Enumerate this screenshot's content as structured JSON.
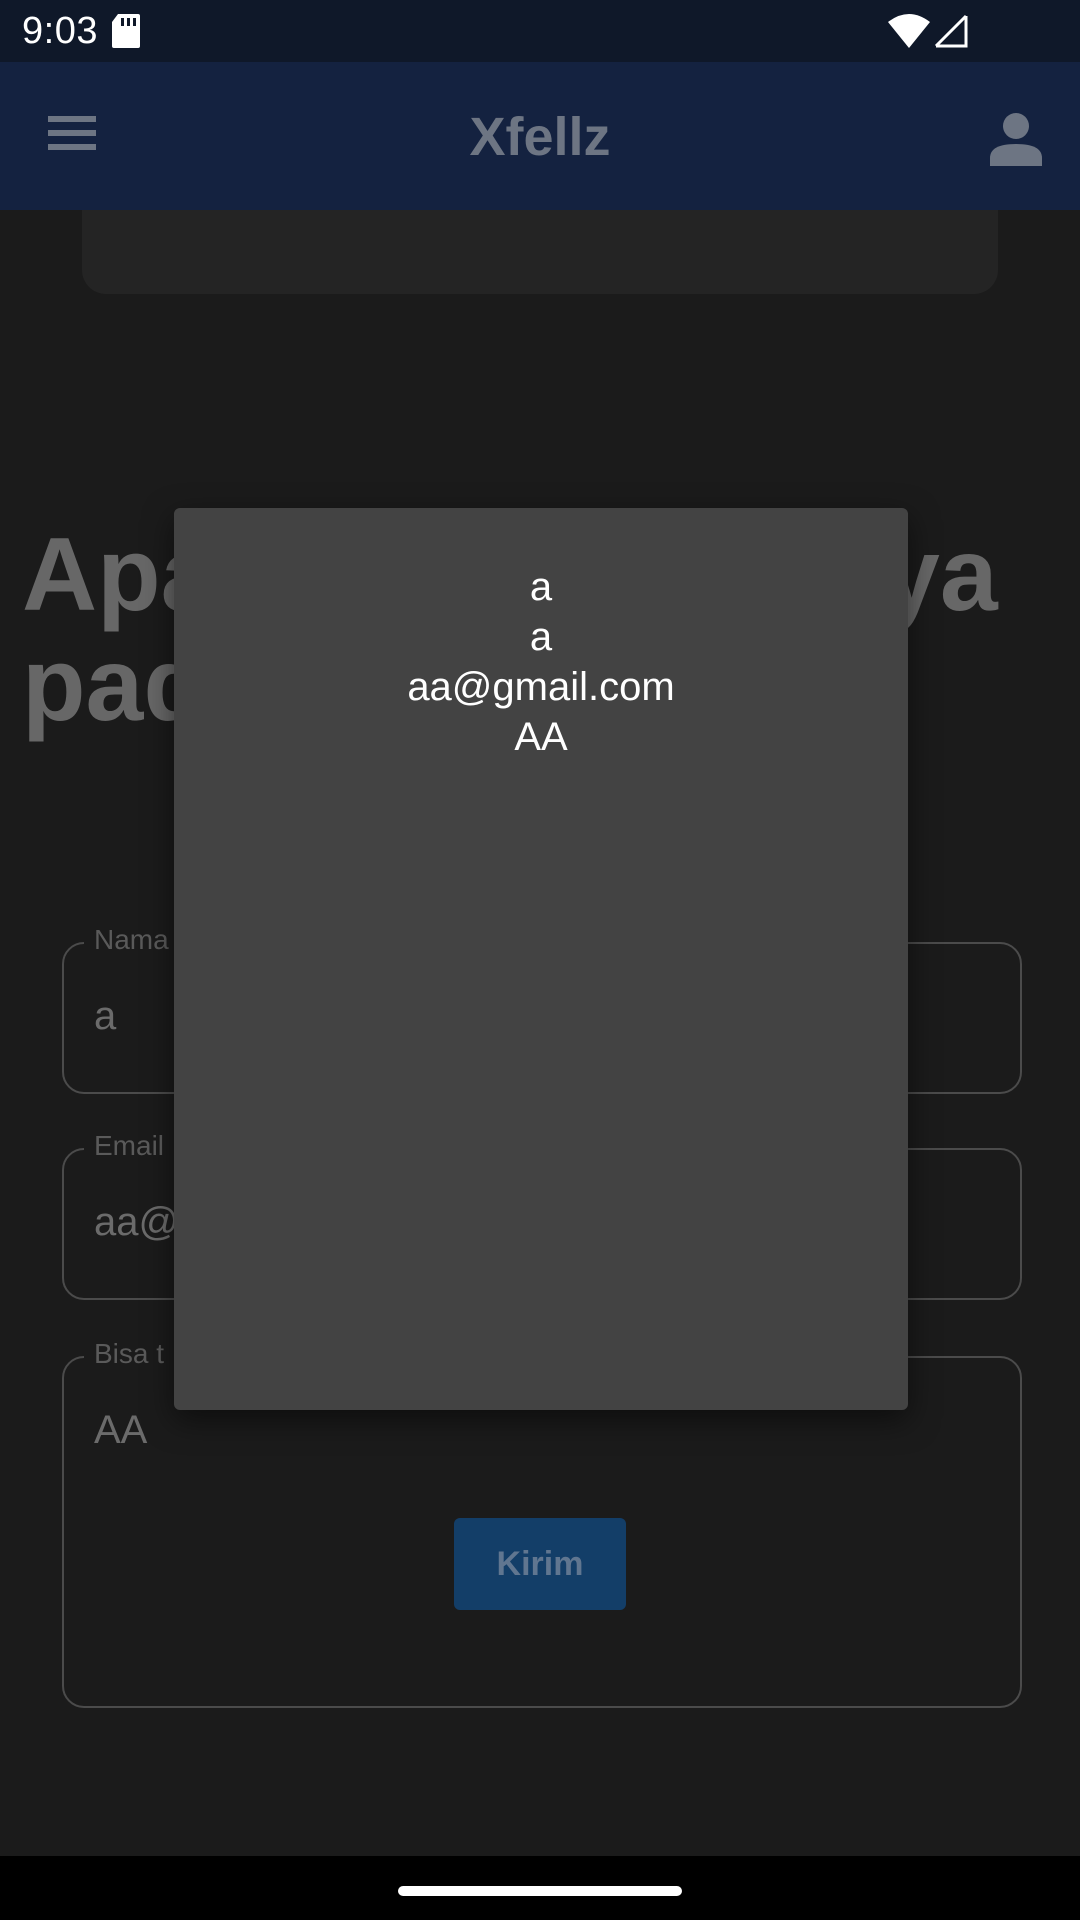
{
  "status_bar": {
    "time": "9:03",
    "icons": [
      "sd-card-icon",
      "wifi-icon",
      "signal-icon"
    ]
  },
  "app_bar": {
    "title": "Xfellz",
    "left_icon": "menu-icon",
    "right_icon": "account-icon"
  },
  "page": {
    "heading_line1_start": "Apa",
    "heading_line1_end": "ya",
    "heading_line2_start": "pad",
    "heading_trailing_mark": "?"
  },
  "form": {
    "name": {
      "label": "Nama",
      "value": "a"
    },
    "email": {
      "label": "Email",
      "value": "aa@"
    },
    "message": {
      "label": "Bisa t",
      "value": "AA"
    },
    "submit_label": "Kirim"
  },
  "dialog": {
    "lines": [
      "a",
      "a",
      "aa@gmail.com",
      "AA"
    ]
  },
  "colors": {
    "status_bar_bg": "#0f1829",
    "app_bar_bg": "#142240",
    "page_bg": "#1b1b1b",
    "dialog_bg": "#434343",
    "submit_bg": "#133e68"
  }
}
